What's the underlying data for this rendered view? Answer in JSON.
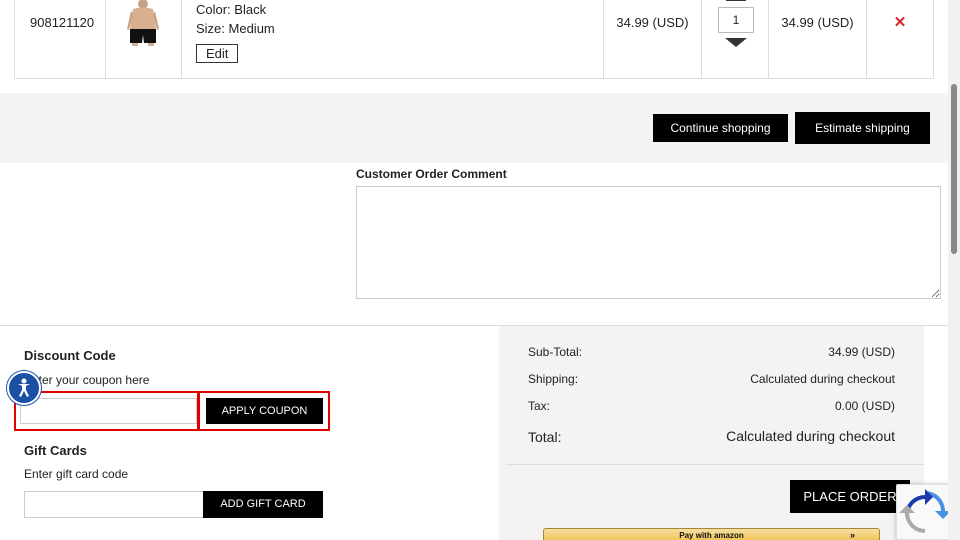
{
  "cart_item": {
    "sku": "908121120",
    "product_image": "boxer-shorts-image",
    "color": "Color: Black",
    "size": "Size: Medium",
    "edit_label": "Edit",
    "price": "34.99 (USD)",
    "quantity": "1",
    "total": "34.99 (USD)",
    "remove_icon": "close-icon",
    "remove_color": "#d9232d"
  },
  "actions": {
    "continue_label": "Continue shopping",
    "estimate_label": "Estimate shipping"
  },
  "comment": {
    "label": "Customer Order Comment",
    "value": ""
  },
  "discount": {
    "title": "Discount Code",
    "subtitle": "Enter your coupon here",
    "input_value": "",
    "apply_label": "APPLY COUPON",
    "highlight_color": "#e00000"
  },
  "gift": {
    "title": "Gift Cards",
    "subtitle": "Enter gift card code",
    "input_value": "",
    "add_label": "ADD GIFT CARD"
  },
  "summary": {
    "subtotal_label": "Sub-Total:",
    "subtotal_value": "34.99 (USD)",
    "shipping_label": "Shipping:",
    "shipping_value": "Calculated during checkout",
    "tax_label": "Tax:",
    "tax_value": "0.00 (USD)",
    "total_label": "Total:",
    "total_value": "Calculated during checkout",
    "place_order_label": "PLACE ORDER",
    "amazon_label": "Pay with amazon",
    "amazon_arrows": "»"
  },
  "widgets": {
    "accessibility_icon": "accessibility-icon",
    "recaptcha_icon": "recaptcha-icon",
    "accent": "#1a4fa3"
  }
}
